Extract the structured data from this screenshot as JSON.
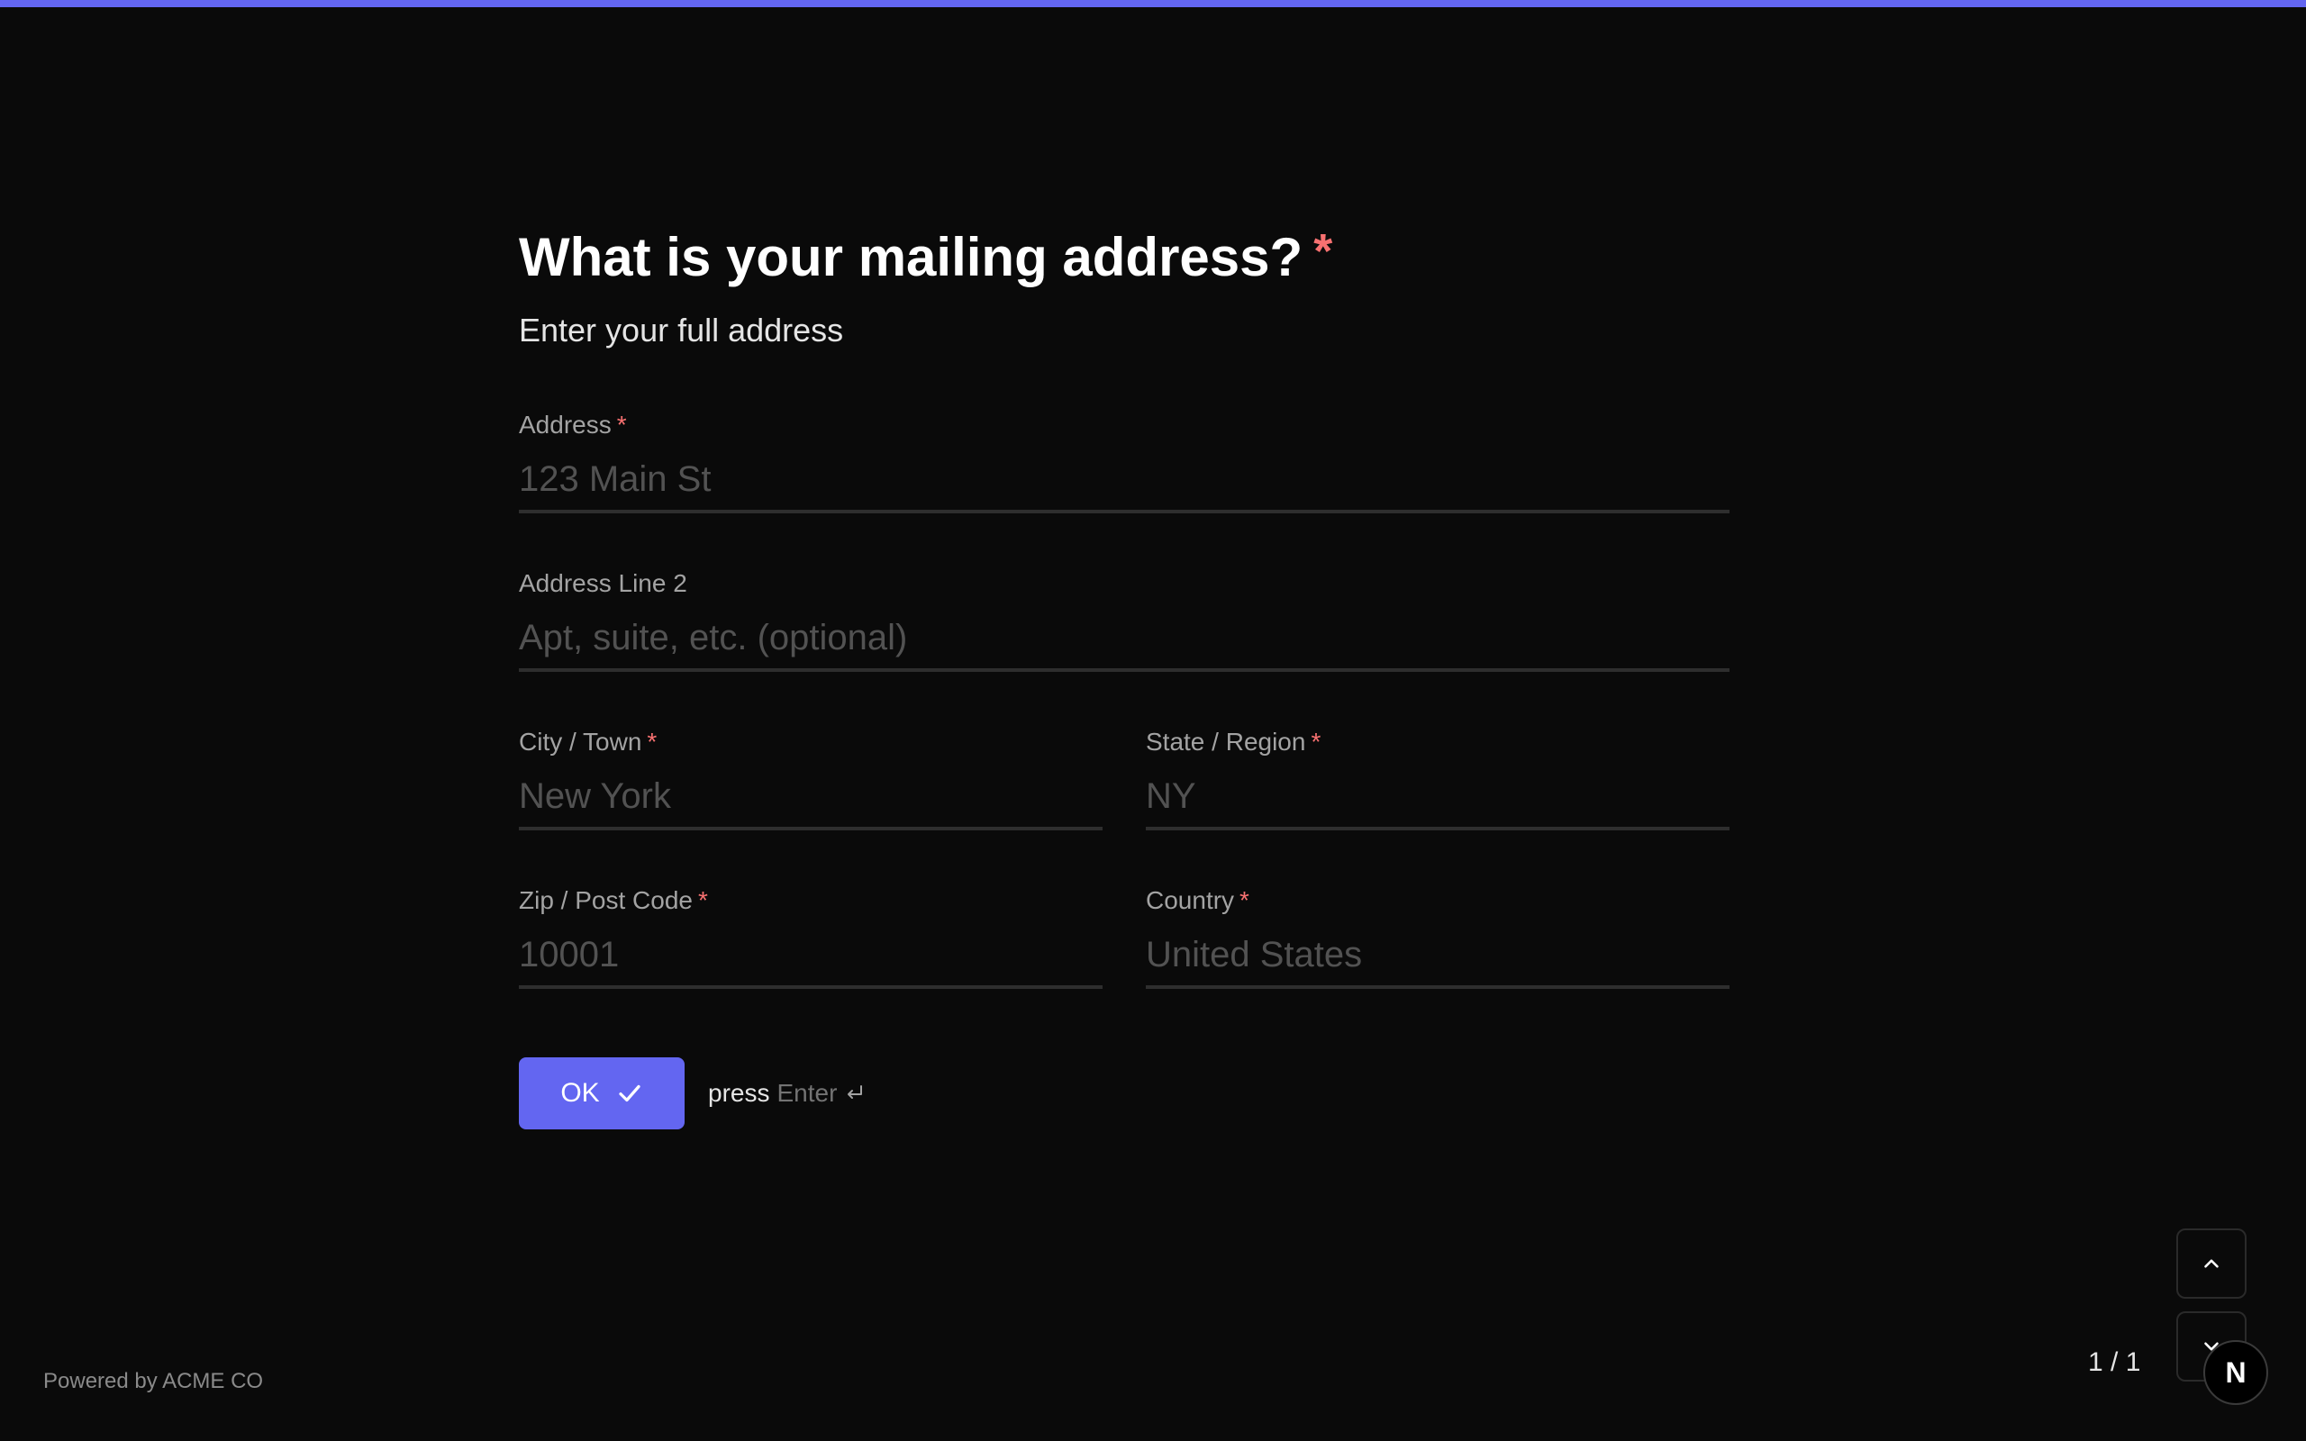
{
  "progress": {
    "fraction": 1.0,
    "color": "#6366f1"
  },
  "question": {
    "title": "What is your mailing address?",
    "required_mark": "*",
    "subtitle": "Enter your full address"
  },
  "fields": {
    "address": {
      "label": "Address",
      "required_mark": "*",
      "placeholder": "123 Main St",
      "value": ""
    },
    "address2": {
      "label": "Address Line 2",
      "placeholder": "Apt, suite, etc. (optional)",
      "value": ""
    },
    "city": {
      "label": "City / Town",
      "required_mark": "*",
      "placeholder": "New York",
      "value": ""
    },
    "state": {
      "label": "State / Region",
      "required_mark": "*",
      "placeholder": "NY",
      "value": ""
    },
    "zip": {
      "label": "Zip / Post Code",
      "required_mark": "*",
      "placeholder": "10001",
      "value": ""
    },
    "country": {
      "label": "Country",
      "required_mark": "*",
      "placeholder": "United States",
      "value": ""
    }
  },
  "actions": {
    "ok_label": "OK",
    "ok_icon": "check-icon",
    "hint_prefix": "press",
    "hint_key": "Enter",
    "hint_icon": "enter-return-icon"
  },
  "footer": {
    "powered_by": "Powered by ACME CO"
  },
  "navigation": {
    "page_indicator": "1 / 1",
    "up_icon": "chevron-up-icon",
    "down_icon": "chevron-down-icon",
    "badge_letter": "N"
  },
  "colors": {
    "background": "#0a0a0a",
    "accent": "#6366f1",
    "required": "#f87171"
  }
}
